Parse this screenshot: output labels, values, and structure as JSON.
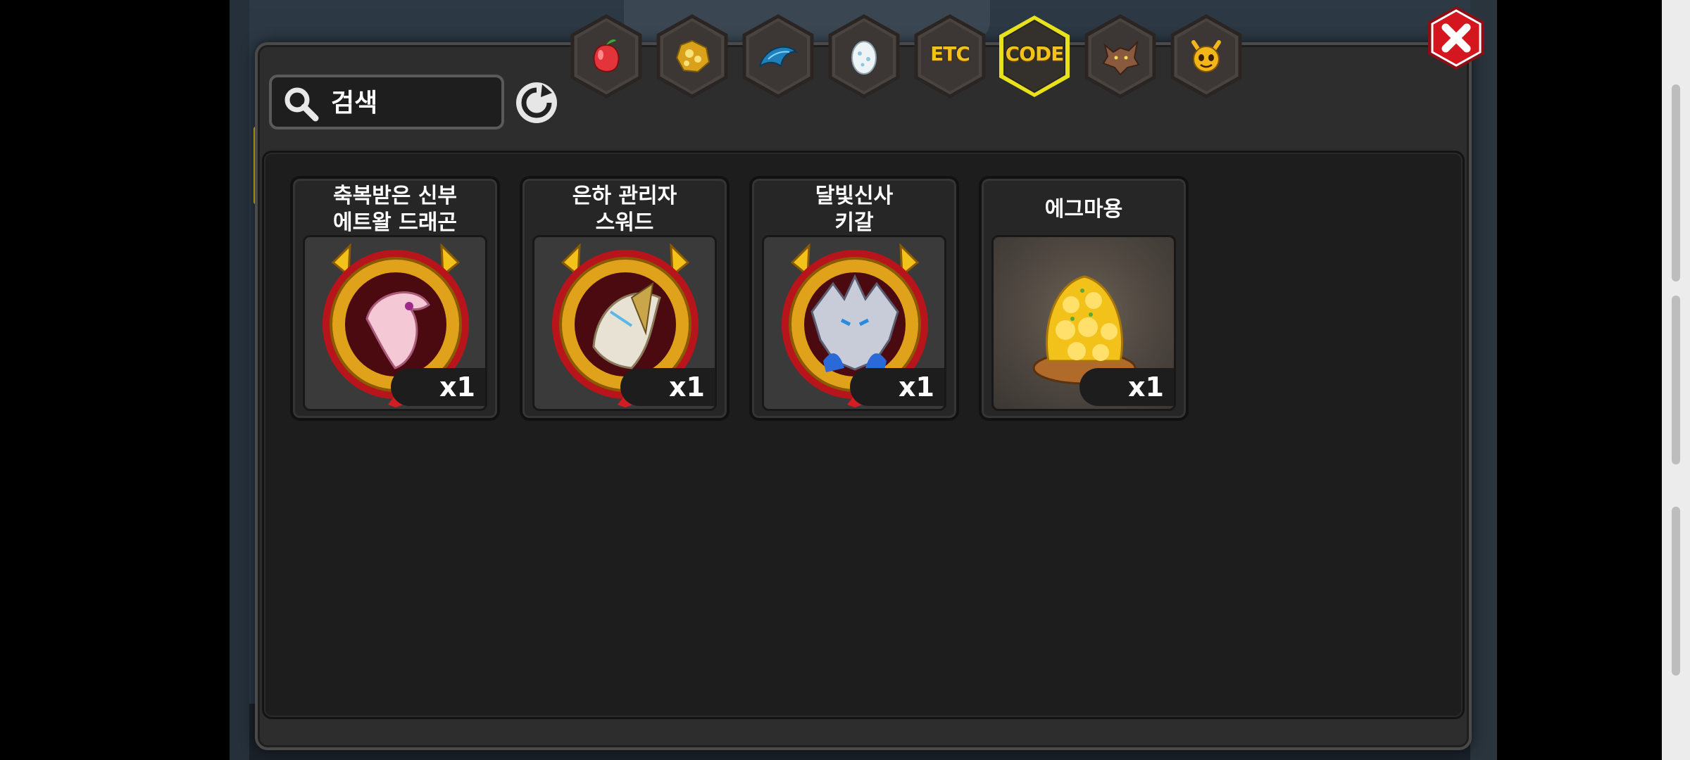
{
  "search": {
    "placeholder": "검색",
    "value": ""
  },
  "tabs": [
    {
      "id": "fruit",
      "label": "",
      "icon": "fruit-icon",
      "selected": false
    },
    {
      "id": "gold",
      "label": "",
      "icon": "gold-ore-icon",
      "selected": false
    },
    {
      "id": "scale",
      "label": "",
      "icon": "dragon-scale-icon",
      "selected": false
    },
    {
      "id": "egg",
      "label": "",
      "icon": "egg-icon",
      "selected": false
    },
    {
      "id": "etc",
      "label": "ETC",
      "icon": "",
      "selected": false
    },
    {
      "id": "code",
      "label": "CODE",
      "icon": "",
      "selected": true
    },
    {
      "id": "beast",
      "label": "",
      "icon": "wolf-head-icon",
      "selected": false
    },
    {
      "id": "emote",
      "label": "",
      "icon": "horned-face-icon",
      "selected": false
    }
  ],
  "items": [
    {
      "name_line1": "축복받은 신부",
      "name_line2": "에트왈 드래곤",
      "qty": "x1",
      "type": "dragon-medal"
    },
    {
      "name_line1": "은하 관리자",
      "name_line2": "스워드",
      "qty": "x1",
      "type": "dragon-medal"
    },
    {
      "name_line1": "달빛신사",
      "name_line2": "키갈",
      "qty": "x1",
      "type": "dragon-medal"
    },
    {
      "name_line1": "에그마용",
      "name_line2": "",
      "qty": "x1",
      "type": "gold-pile"
    }
  ],
  "colors": {
    "tab_gold": "#f2c21a",
    "selected_outline": "#e8e21a",
    "close_red": "#d4161f"
  }
}
